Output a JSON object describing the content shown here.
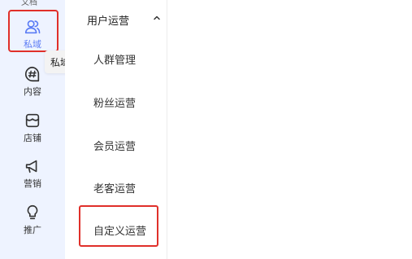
{
  "sidebar": {
    "top_partial_label": "文档",
    "items": [
      {
        "label": "私域",
        "icon": "users-icon",
        "active": true
      },
      {
        "label": "内容",
        "icon": "hashtag-chat-icon",
        "active": false
      },
      {
        "label": "店铺",
        "icon": "storefront-icon",
        "active": false
      },
      {
        "label": "营销",
        "icon": "megaphone-icon",
        "active": false
      },
      {
        "label": "推广",
        "icon": "lightbulb-icon",
        "active": false
      }
    ],
    "tooltip": "私域"
  },
  "submenu": {
    "header": "用户运营",
    "items": [
      {
        "label": "人群管理"
      },
      {
        "label": "粉丝运营"
      },
      {
        "label": "会员运营"
      },
      {
        "label": "老客运营"
      },
      {
        "label": "自定义运营"
      }
    ]
  },
  "colors": {
    "rail_bg": "#eef3ff",
    "accent": "#5b7cf5",
    "highlight": "#e0302a"
  }
}
